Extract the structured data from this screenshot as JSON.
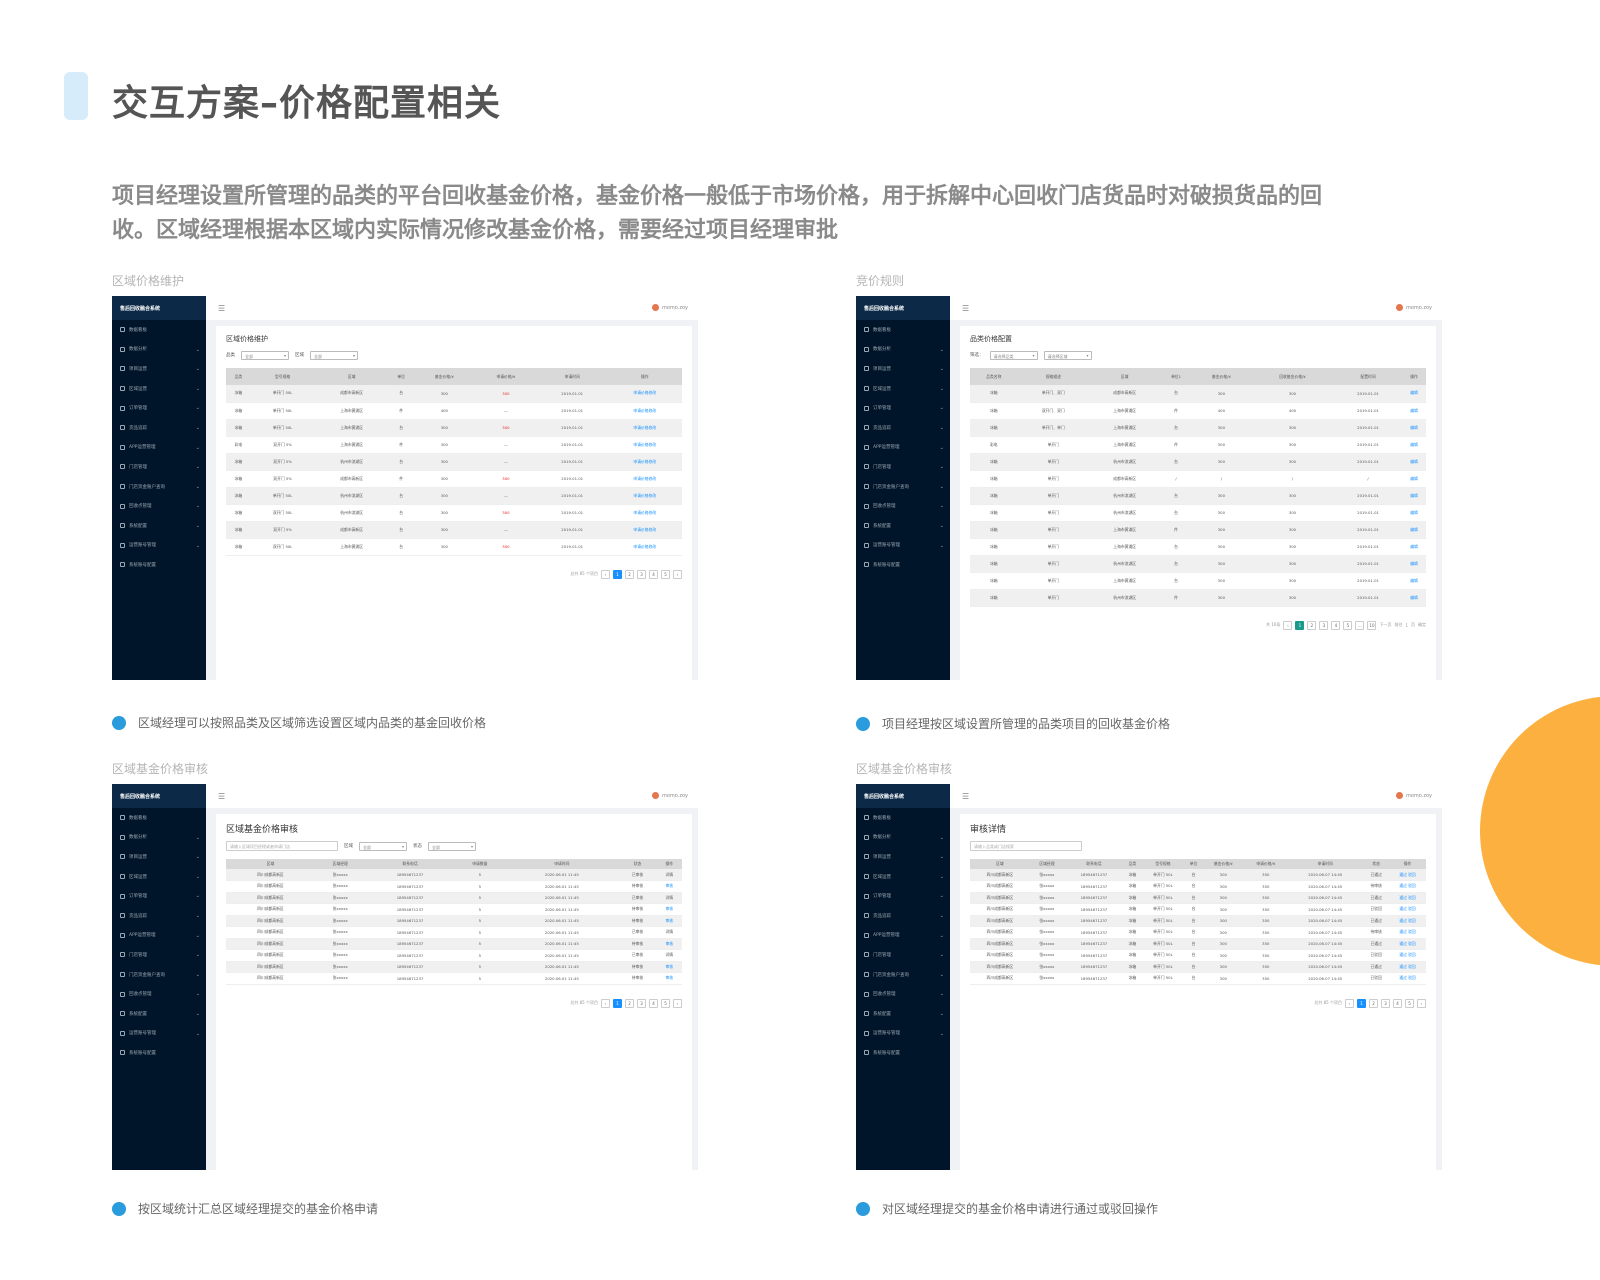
{
  "page_title": "交互方案–价格配置相关",
  "intro": "项目经理设置所管理的品类的平台回收基金价格，基金价格一般低于市场价格，用于拆解中心回收门店货品时对破损货品的回收。区域经理根据本区域内实际情况修改基金价格，需要经过项目经理审批",
  "colors": {
    "accent_bar": "#d6ecfa",
    "dot": "#2a9bdc",
    "circle": "#fbb040",
    "sidebar": "#001529"
  },
  "app_common": {
    "brand": "售后回收融合系统",
    "user": "momo.zoy",
    "menu": [
      "数据看板",
      "数据分析",
      "项目运营",
      "区域运营",
      "订单管理",
      "货品追踪",
      "APP运营管理",
      "门店管理",
      "门店资金账户查询",
      "回收点管理",
      "系统配置",
      "运营账号管理",
      "系统账号配置"
    ]
  },
  "panels": [
    {
      "label": "区域价格维护",
      "caption": "区域经理可以按照品类及区域筛选设置区域内品类的基金回收价格",
      "title": "区域价格维护",
      "filters": [
        {
          "label": "品类",
          "value": "全部"
        },
        {
          "label": "区域",
          "value": "全部"
        }
      ],
      "columns": [
        "品类",
        "型号规格",
        "区域",
        "单位",
        "基金价格/¥",
        "申请价格/¥",
        "申请时间",
        "操作"
      ],
      "rows": [
        [
          "冰箱",
          "单开门 50L",
          "成都市高新区",
          "台",
          "300",
          "300",
          "2019.01.01",
          "申请价格修改"
        ],
        [
          "冰箱",
          "单开门 50L",
          "上海市黄浦区",
          "件",
          "400",
          "—",
          "2019.01.01",
          "申请价格修改"
        ],
        [
          "冰箱",
          "单开门 50L",
          "上海市黄浦区",
          "台",
          "300",
          "300",
          "2019.01.01",
          "申请价格修改"
        ],
        [
          "彩电",
          "双开门 5%",
          "上海市黄浦区",
          "件",
          "300",
          "—",
          "2019.01.01",
          "申请价格修改"
        ],
        [
          "冰箱",
          "双开门 5%",
          "杭州市滨湖区",
          "台",
          "300",
          "—",
          "2019.01.01",
          "申请价格修改"
        ],
        [
          "冰箱",
          "双开门 5%",
          "成都市高新区",
          "件",
          "300",
          "300",
          "2019.01.01",
          "申请价格修改"
        ],
        [
          "冰箱",
          "单开门 50L",
          "杭州市滨湖区",
          "台",
          "300",
          "—",
          "2019.01.01",
          "申请价格修改"
        ],
        [
          "冰箱",
          "双开门 50L",
          "杭州市滨湖区",
          "台",
          "300",
          "300",
          "2019.01.01",
          "申请价格修改"
        ],
        [
          "冰箱",
          "双开门 5%",
          "成都市高新区",
          "台",
          "300",
          "—",
          "2019.01.01",
          "申请价格修改"
        ],
        [
          "冰箱",
          "双开门 50L",
          "上海市黄浦区",
          "台",
          "300",
          "300",
          "2019.01.01",
          "申请价格修改"
        ]
      ],
      "pager_text": "总共 85 个项目",
      "pages": [
        "1",
        "2",
        "3",
        "4",
        "5"
      ]
    },
    {
      "label": "竞价规则",
      "caption": "项目经理按区域设置所管理的品类项目的回收基金价格",
      "title": "品类价格配置",
      "filter_label": "筛选：",
      "filters": [
        {
          "value": "请选择品类"
        },
        {
          "value": "请选择区域"
        }
      ],
      "columns": [
        "品类名称",
        "规格描述",
        "区域",
        "单位1",
        "基金价格/¥",
        "回收基金价格/¥",
        "配置时间",
        "操作"
      ],
      "rows": [
        [
          "冰箱",
          "单开门、双门",
          "成都市高新区",
          "台",
          "300",
          "300",
          "2019.01.01",
          "编辑"
        ],
        [
          "冰箱",
          "双开门、双门",
          "上海市黄浦区",
          "件",
          "400",
          "400",
          "2019.01.01",
          "编辑"
        ],
        [
          "冰箱",
          "单开门、单门",
          "上海市黄浦区",
          "台",
          "300",
          "300",
          "2019.01.01",
          "编辑"
        ],
        [
          "彩电",
          "单开门",
          "上海市黄浦区",
          "件",
          "300",
          "300",
          "2019.01.01",
          "编辑"
        ],
        [
          "冰箱",
          "单开门",
          "杭州市滨湖区",
          "台",
          "300",
          "300",
          "2019.01.01",
          "编辑"
        ],
        [
          "冰箱",
          "单开门",
          "成都市高新区",
          "/",
          "/",
          "/",
          "/",
          "编辑"
        ],
        [
          "冰箱",
          "单开门",
          "杭州市滨湖区",
          "台",
          "300",
          "300",
          "2019.01.01",
          "编辑"
        ],
        [
          "冰箱",
          "单开门",
          "杭州市滨湖区",
          "台",
          "300",
          "300",
          "2019.01.01",
          "编辑"
        ],
        [
          "冰箱",
          "单开门",
          "上海市黄浦区",
          "件",
          "300",
          "300",
          "2019.01.01",
          "编辑"
        ],
        [
          "冰箱",
          "单开门",
          "上海市黄浦区",
          "台",
          "300",
          "300",
          "2019.01.01",
          "编辑"
        ],
        [
          "冰箱",
          "单开门",
          "杭州市滨湖区",
          "台",
          "300",
          "300",
          "2019.01.01",
          "编辑"
        ],
        [
          "冰箱",
          "单开门",
          "上海市黄浦区",
          "台",
          "300",
          "300",
          "2019.01.01",
          "编辑"
        ],
        [
          "冰箱",
          "单开门",
          "杭州市滨湖区",
          "件",
          "300",
          "300",
          "2019.01.01",
          "编辑"
        ]
      ],
      "pager_text": "共 16条",
      "pages": [
        "1",
        "2",
        "3",
        "4",
        "5",
        "...",
        "10"
      ],
      "pager_extra": [
        "下一页",
        "前往",
        "1",
        "页",
        "确定"
      ]
    },
    {
      "label": "区域基金价格审核",
      "caption": "按区域统计汇总区域经理提交的基金价格申请",
      "title": "区域基金价格审核",
      "search_placeholder": "请输入区域项目经理或者申请门店",
      "filters": [
        {
          "label": "区域",
          "value": "全部"
        },
        {
          "label": "状态",
          "value": "全部"
        }
      ],
      "columns": [
        "区域",
        "区域经理",
        "联系电话",
        "申请数量",
        "申请时间",
        "状态",
        "操作"
      ],
      "rows": [
        [
          "四川成都高新区",
          "张xxxxx",
          "18954671237",
          "5",
          "2020.06.01 11:45",
          "已审核",
          "详情"
        ],
        [
          "四川成都高新区",
          "张xxxxx",
          "18954671237",
          "5",
          "2020.06.01 11:45",
          "待审核",
          "审核"
        ],
        [
          "四川成都高新区",
          "张xxxxx",
          "18954671237",
          "5",
          "2020.06.01 11:45",
          "已审核",
          "详情"
        ],
        [
          "四川成都高新区",
          "张xxxxx",
          "18954671237",
          "5",
          "2020.06.01 11:45",
          "待审核",
          "审核"
        ],
        [
          "四川成都高新区",
          "张xxxxx",
          "18954671237",
          "5",
          "2020.06.01 11:45",
          "待审核",
          "审核"
        ],
        [
          "四川成都高新区",
          "张xxxxx",
          "18954671237",
          "5",
          "2020.06.01 11:45",
          "已审核",
          "详情"
        ],
        [
          "四川成都高新区",
          "张xxxxx",
          "18954671237",
          "5",
          "2020.06.01 11:45",
          "待审核",
          "审核"
        ],
        [
          "四川成都高新区",
          "张xxxxx",
          "18954671237",
          "5",
          "2020.06.01 11:45",
          "已审核",
          "详情"
        ],
        [
          "四川成都高新区",
          "张xxxxx",
          "18954671237",
          "5",
          "2020.06.01 11:45",
          "待审核",
          "审核"
        ],
        [
          "四川成都高新区",
          "张xxxxx",
          "18954671237",
          "5",
          "2020.06.01 11:45",
          "待审核",
          "审核"
        ]
      ],
      "pager_text": "总共 85 个项目",
      "pages": [
        "1",
        "2",
        "3",
        "4",
        "5"
      ]
    },
    {
      "label": "区域基金价格审核",
      "caption": "对区域经理提交的基金价格申请进行通过或驳回操作",
      "title": "审核详情",
      "search_placeholder": "请输入品类或门店搜索",
      "columns": [
        "区域",
        "区域经理",
        "联系电话",
        "品类",
        "型号规格",
        "单位",
        "基金价格/¥",
        "申请价格/¥",
        "申请时间",
        "状态",
        "操作"
      ],
      "rows": [
        [
          "四川成都高新区",
          "张xxxxx",
          "18954671237",
          "冰箱",
          "单开门 50L",
          "台",
          "300",
          "350",
          "2020.06.07 14:45",
          "已通过",
          "通过 驳回"
        ],
        [
          "四川成都高新区",
          "张xxxxx",
          "18954671237",
          "冰箱",
          "单开门 50L",
          "台",
          "300",
          "350",
          "2020.06.07 14:45",
          "待审核",
          "通过 驳回"
        ],
        [
          "四川成都高新区",
          "张xxxxx",
          "18954671237",
          "冰箱",
          "单开门 50L",
          "台",
          "300",
          "350",
          "2020.06.07 14:45",
          "已通过",
          "通过 驳回"
        ],
        [
          "四川成都高新区",
          "张xxxxx",
          "18954671237",
          "冰箱",
          "单开门 50L",
          "台",
          "300",
          "350",
          "2020.06.07 14:45",
          "已驳回",
          "通过 驳回"
        ],
        [
          "四川成都高新区",
          "张xxxxx",
          "18954671237",
          "冰箱",
          "单开门 50L",
          "台",
          "300",
          "350",
          "2020.06.07 14:45",
          "已通过",
          "通过 驳回"
        ],
        [
          "四川成都高新区",
          "张xxxxx",
          "18954671237",
          "冰箱",
          "单开门 50L",
          "台",
          "300",
          "350",
          "2020.06.07 14:45",
          "待审核",
          "通过 驳回"
        ],
        [
          "四川成都高新区",
          "张xxxxx",
          "18954671237",
          "冰箱",
          "单开门 50L",
          "台",
          "300",
          "350",
          "2020.06.07 14:45",
          "已通过",
          "通过 驳回"
        ],
        [
          "四川成都高新区",
          "张xxxxx",
          "18954671237",
          "冰箱",
          "单开门 50L",
          "台",
          "300",
          "350",
          "2020.06.07 14:45",
          "已驳回",
          "通过 驳回"
        ],
        [
          "四川成都高新区",
          "张xxxxx",
          "18954671237",
          "冰箱",
          "单开门 50L",
          "台",
          "300",
          "350",
          "2020.06.07 14:45",
          "已通过",
          "通过 驳回"
        ],
        [
          "四川成都高新区",
          "张xxxxx",
          "18954671237",
          "冰箱",
          "单开门 50L",
          "台",
          "300",
          "350",
          "2020.06.07 14:45",
          "已驳回",
          "通过 驳回"
        ]
      ],
      "pager_text": "总共 85 个项目",
      "pages": [
        "1",
        "2",
        "3",
        "4",
        "5"
      ]
    }
  ]
}
